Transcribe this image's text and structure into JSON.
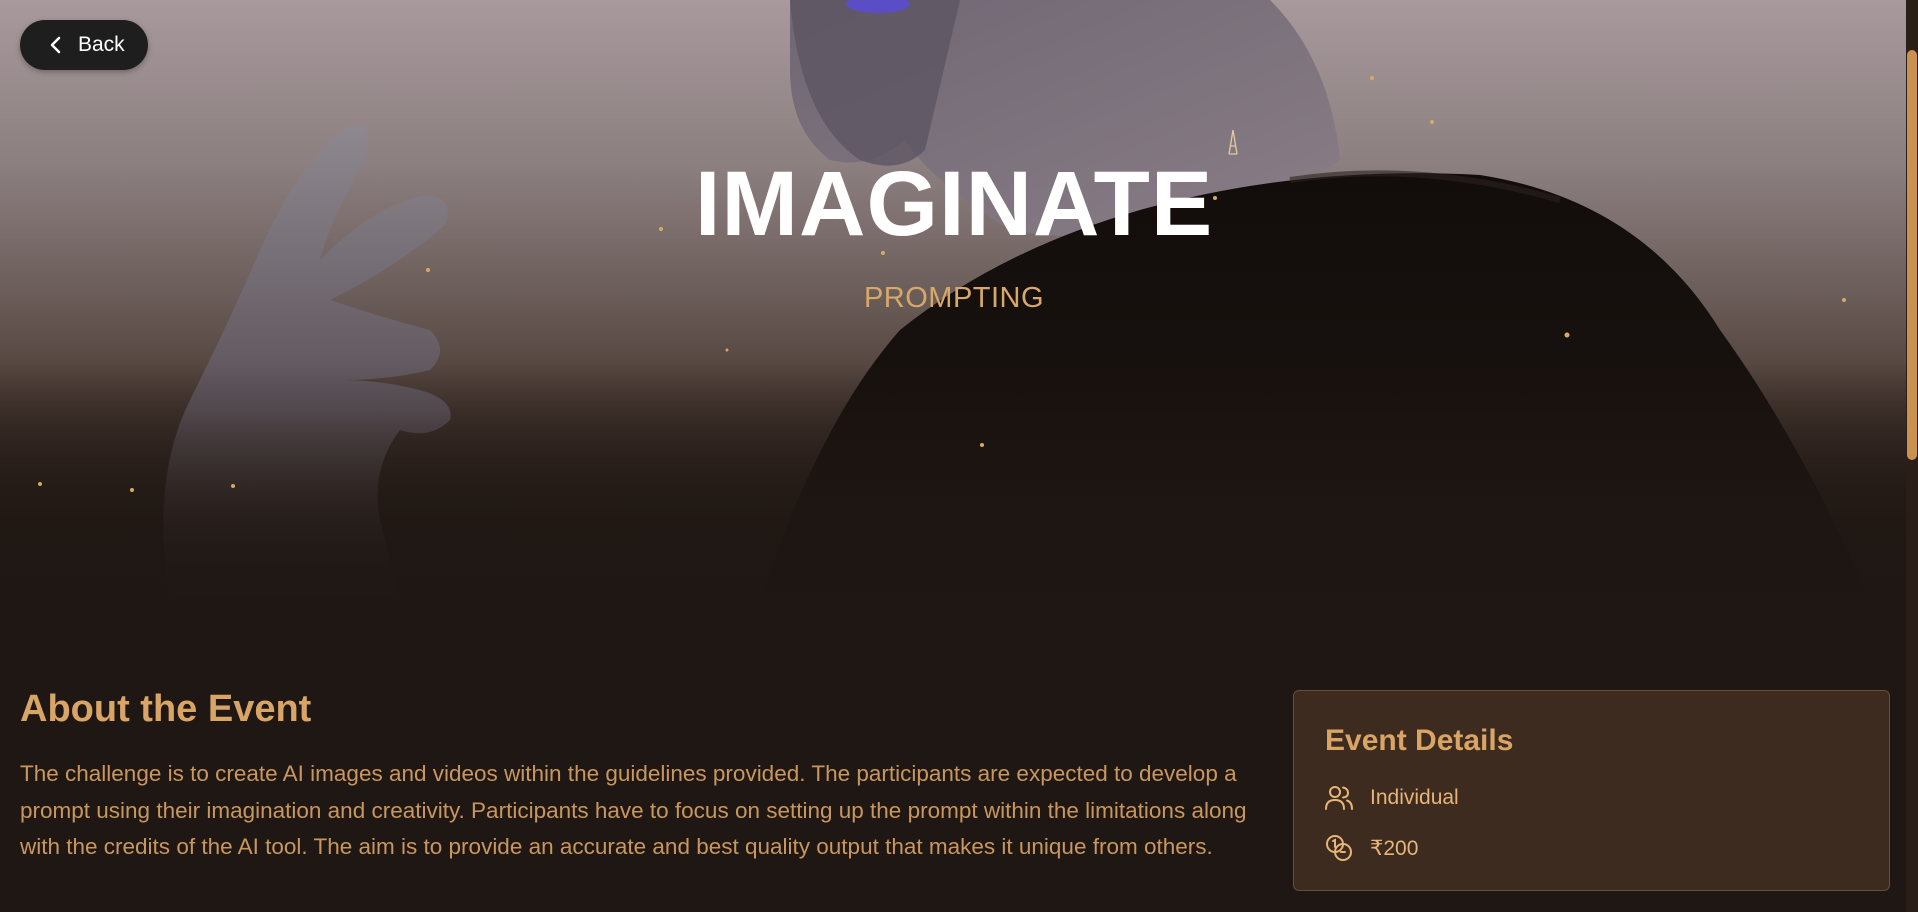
{
  "nav": {
    "back_label": "Back"
  },
  "hero": {
    "title": "IMAGINATE",
    "subtitle": "PROMPTING"
  },
  "about": {
    "heading": "About the Event",
    "text": "The challenge is to create AI images and videos within the guidelines provided. The participants are expected to develop a prompt using their imagination and creativity. Participants have to focus on setting up the prompt within the limitations along with the credits of the AI tool. The aim is to provide an accurate and best quality output that makes it unique from others."
  },
  "details": {
    "title": "Event Details",
    "items": [
      {
        "icon": "users-icon",
        "label": "Individual"
      },
      {
        "icon": "coins-icon",
        "label": "₹200"
      }
    ]
  },
  "colors": {
    "accent": "#d9a566",
    "background": "#1f1713",
    "card": "#3d2b20",
    "scrollbar_thumb": "#c99250"
  }
}
